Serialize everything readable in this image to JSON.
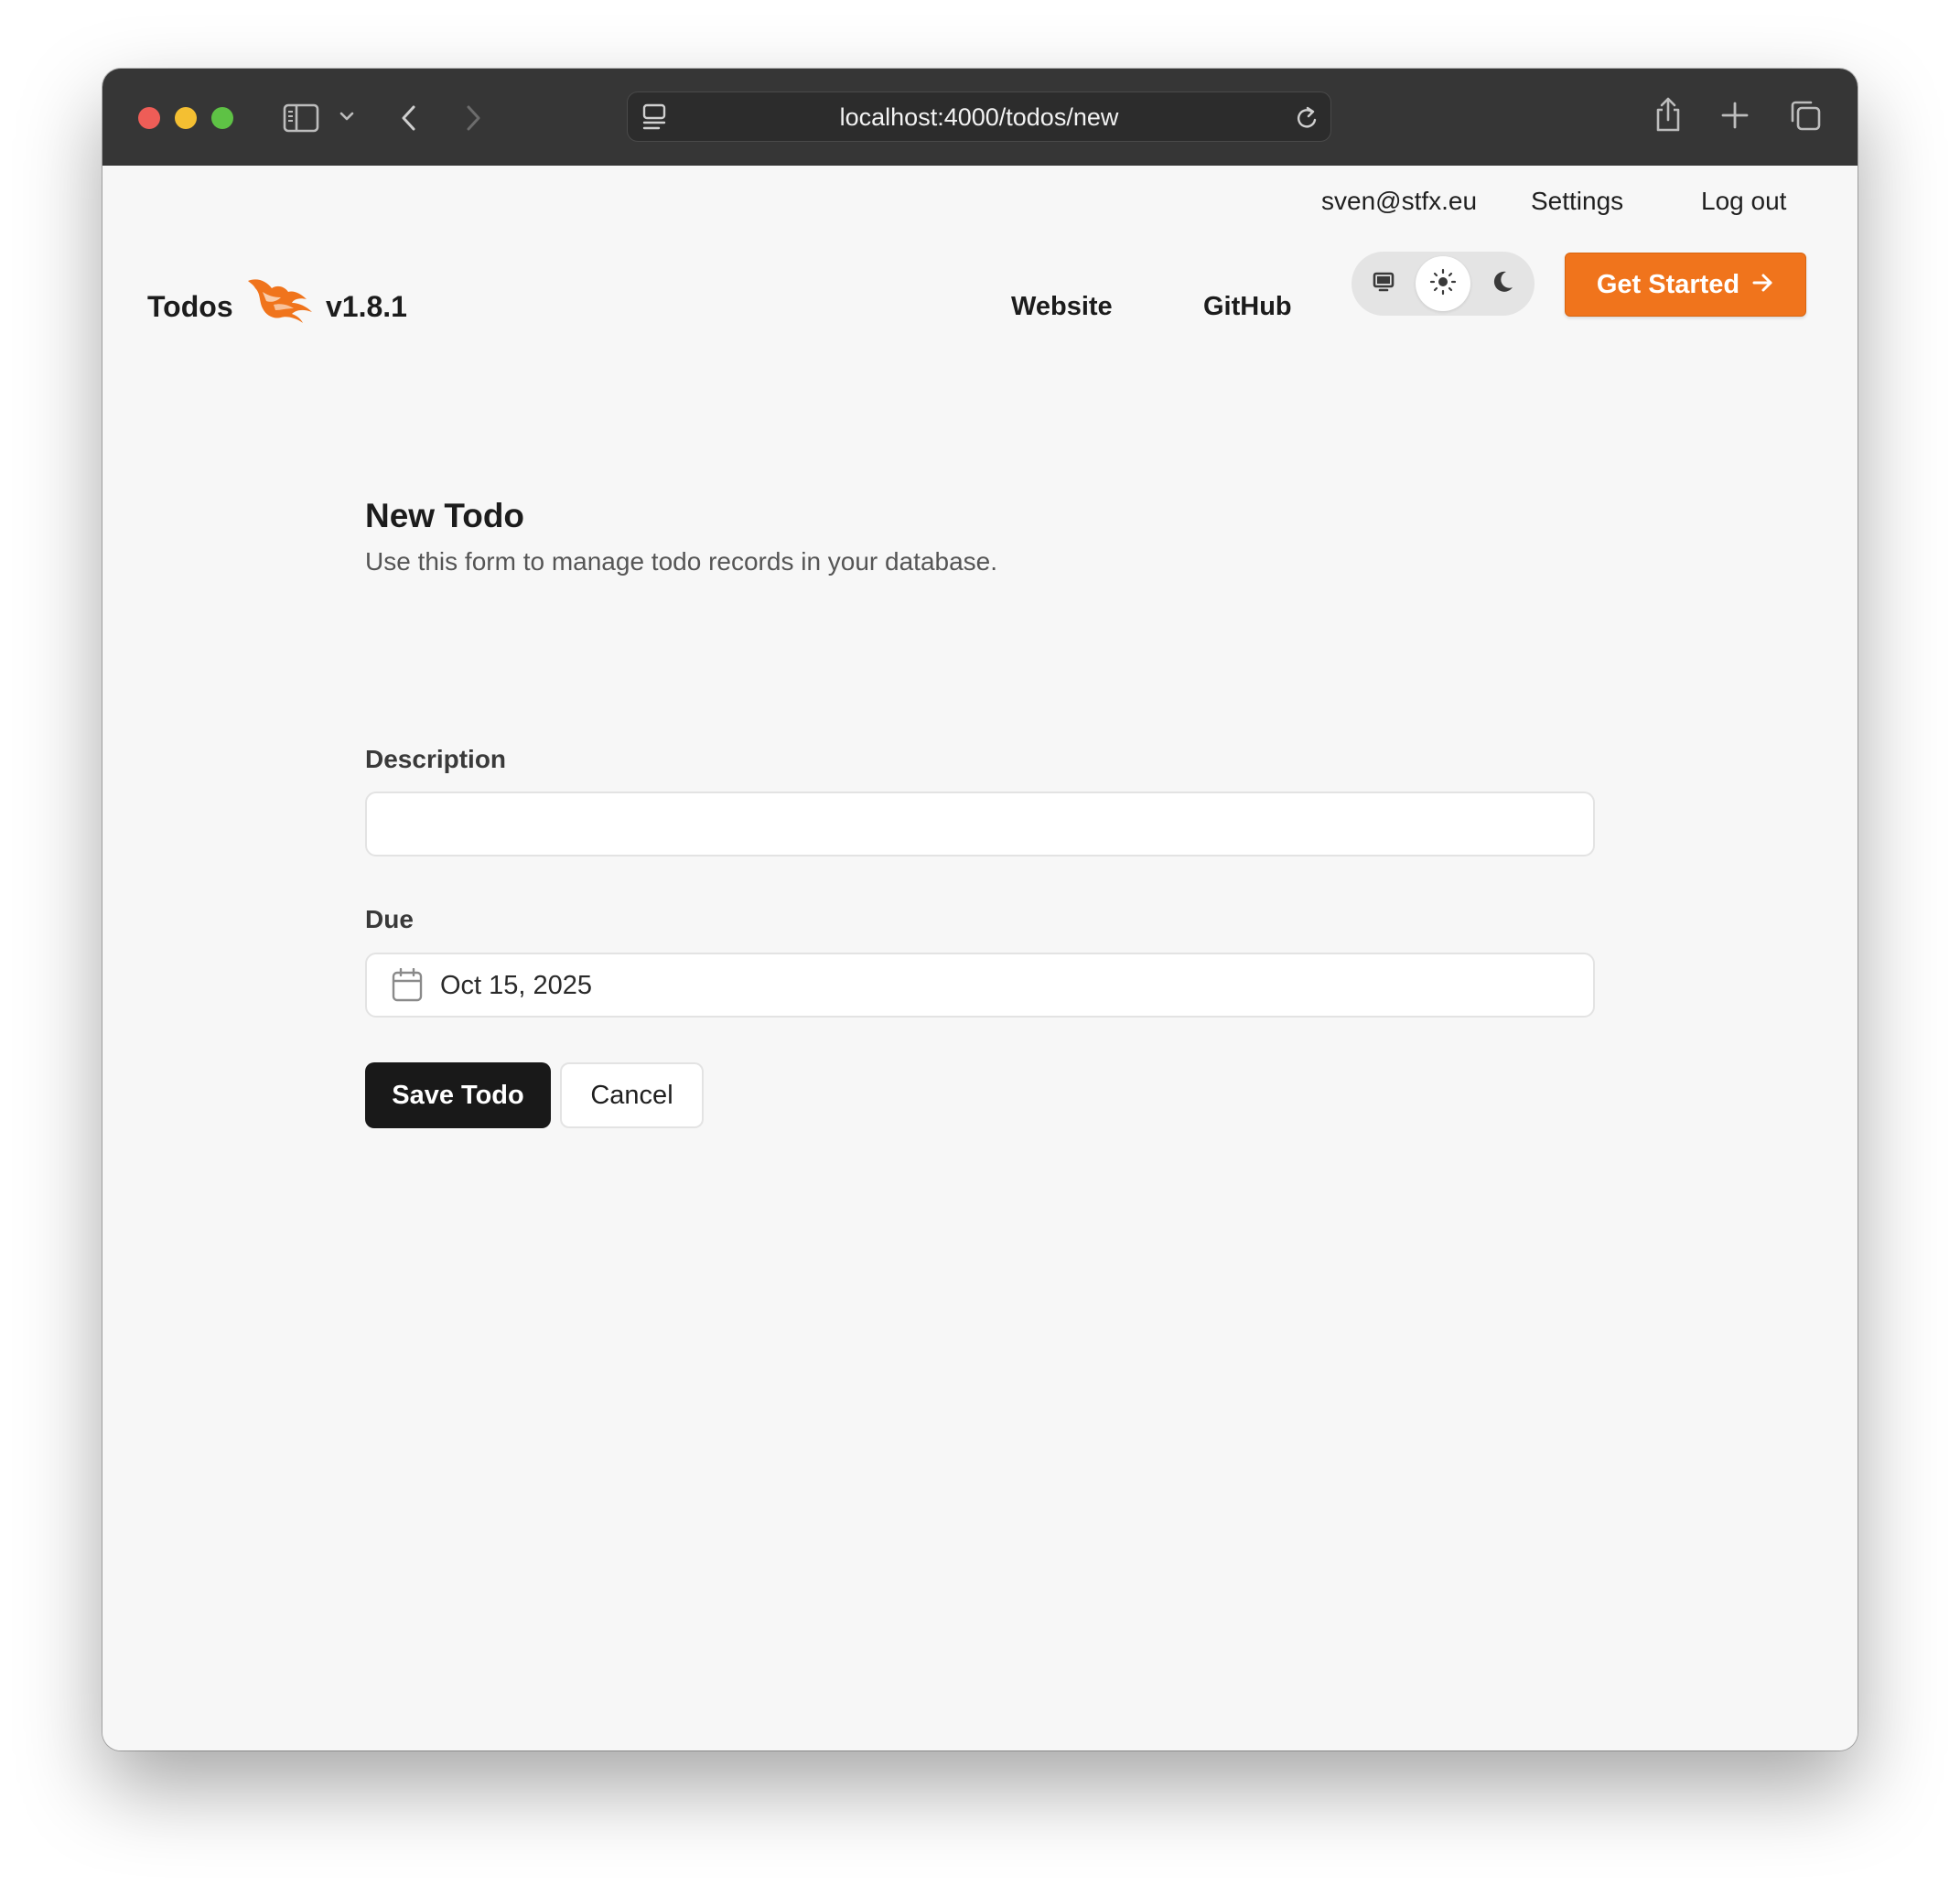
{
  "browser": {
    "url": "localhost:4000/todos/new"
  },
  "user_nav": {
    "email": "sven@stfx.eu",
    "settings": "Settings",
    "logout": "Log out"
  },
  "header": {
    "brand": "Todos",
    "version": "v1.8.1",
    "links": {
      "website": "Website",
      "github": "GitHub"
    },
    "theme_options": [
      "system",
      "light",
      "dark"
    ],
    "theme_selected": "light",
    "cta": "Get Started",
    "accent_color": "#f0741c"
  },
  "form": {
    "title": "New Todo",
    "subtitle": "Use this form to manage todo records in your database.",
    "description_label": "Description",
    "description_value": "",
    "due_label": "Due",
    "due_value": "Oct 15, 2025",
    "save_label": "Save Todo",
    "cancel_label": "Cancel"
  }
}
